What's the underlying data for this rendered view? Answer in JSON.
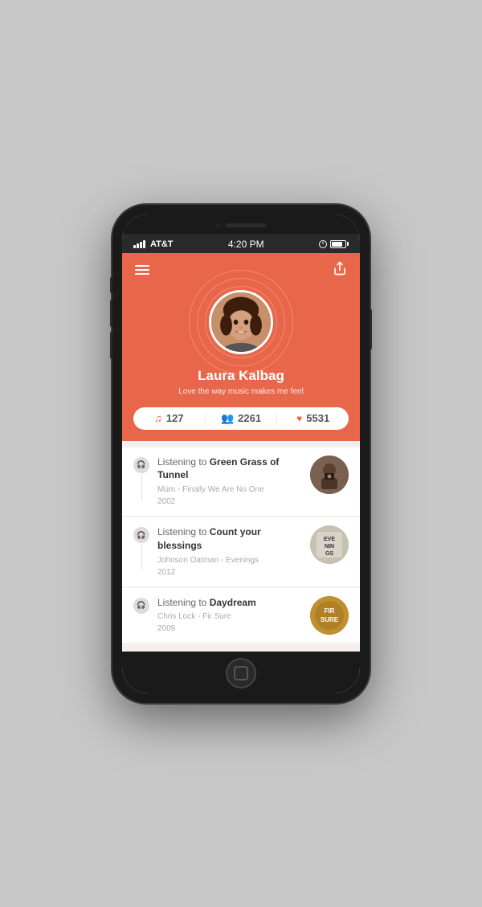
{
  "status_bar": {
    "carrier": "AT&T",
    "time": "4:20 PM"
  },
  "toolbar": {
    "menu_label": "menu",
    "share_label": "share"
  },
  "profile": {
    "name": "Laura Kalbag",
    "bio": "Love the way music makes me feel",
    "avatar_alt": "Laura Kalbag avatar"
  },
  "stats": [
    {
      "icon": "music-note",
      "value": "127"
    },
    {
      "icon": "people",
      "value": "2261"
    },
    {
      "icon": "heart",
      "value": "5531"
    }
  ],
  "feed": [
    {
      "prefix": "Listening to ",
      "title": "Green Grass of Tunnel",
      "meta_line1": "Múm - Finally We Are No One",
      "meta_line2": "2002",
      "thumb_label": ""
    },
    {
      "prefix": "Listening to ",
      "title": "Count your blessings",
      "meta_line1": "Johnson Oatman  - Evenings",
      "meta_line2": "2012",
      "thumb_label": "EVE\nNIN\nGS"
    },
    {
      "prefix": "Listening to ",
      "title": "Daydream",
      "meta_line1": "Chris Lock - Fir Sure",
      "meta_line2": "2009",
      "thumb_label": "FIR\nSURE"
    }
  ]
}
